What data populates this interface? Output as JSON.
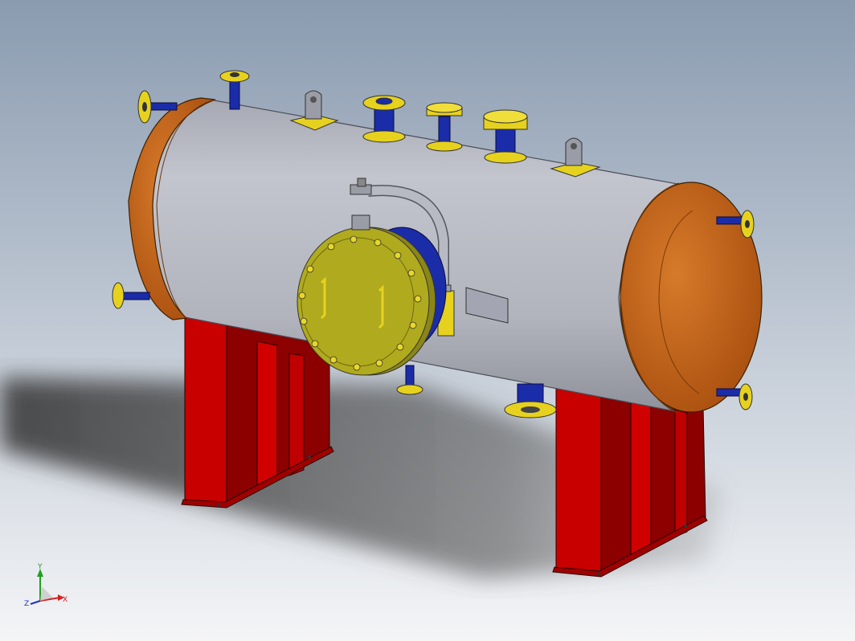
{
  "viewport": {
    "background_top": "#8a9bb0",
    "background_bottom": "#f4f5f7"
  },
  "colors": {
    "shell": "#b9bbc4",
    "head": "#c4651a",
    "saddle": "#c80000",
    "flange": "#e6d21e",
    "nozzle_pipe": "#1a2ca8",
    "manway_cover": "#a7a21c"
  },
  "triad": {
    "x_label": "X",
    "y_label": "Y",
    "z_label": "Z",
    "x_color": "#d42020",
    "y_color": "#20a020",
    "z_color": "#2030c0"
  }
}
